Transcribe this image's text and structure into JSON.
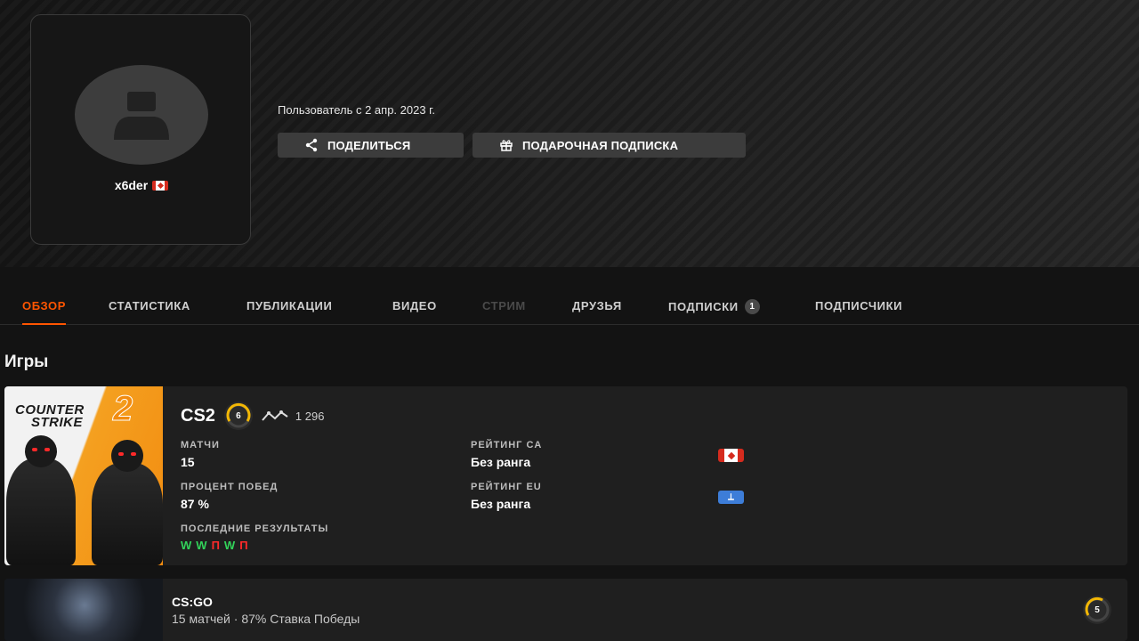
{
  "profile": {
    "nickname": "x6der",
    "member_since": "Пользователь с 2 апр. 2023 г.",
    "country_icon": "flag-canada-icon"
  },
  "actions": {
    "share_label": "ПОДЕЛИТЬСЯ",
    "gift_label": "ПОДАРОЧНАЯ ПОДПИСКА"
  },
  "tabs": [
    {
      "label": "ОБЗОР",
      "state": "active"
    },
    {
      "label": "СТАТИСТИКА",
      "state": "normal"
    },
    {
      "label": "ПУБЛИКАЦИИ",
      "state": "normal"
    },
    {
      "label": "ВИДЕО",
      "state": "normal"
    },
    {
      "label": "СТРИМ",
      "state": "disabled"
    },
    {
      "label": "ДРУЗЬЯ",
      "state": "normal"
    },
    {
      "label": "ПОДПИСКИ",
      "state": "normal",
      "badge": "1"
    },
    {
      "label": "ПОДПИСЧИКИ",
      "state": "normal"
    }
  ],
  "games_section": {
    "title": "Игры"
  },
  "cs2": {
    "cover_text_line1": "COUNTER",
    "cover_text_line2": "STRIKE",
    "cover_text_number": "2",
    "name": "CS2",
    "level": "6",
    "elo": "1 296",
    "matches_label": "МАТЧИ",
    "matches_value": "15",
    "winrate_label": "ПРОЦЕНТ ПОБЕД",
    "winrate_value": "87 %",
    "recent_label": "ПОСЛЕДНИЕ РЕЗУЛЬТАТЫ",
    "recent_results": [
      "W",
      "W",
      "П",
      "W",
      "П"
    ],
    "rating_ca_label": "РЕЙТИНГ CA",
    "rating_ca_value": "Без ранга",
    "rating_eu_label": "РЕЙТИНГ EU",
    "rating_eu_value": "Без ранга"
  },
  "csgo": {
    "name": "CS:GO",
    "summary": "15 матчей · 87% Ставка Победы",
    "level": "5"
  },
  "colors": {
    "accent": "#ff5500",
    "win": "#32d35a",
    "loss": "#ff2a2a",
    "level_ring": "#f2b705"
  }
}
